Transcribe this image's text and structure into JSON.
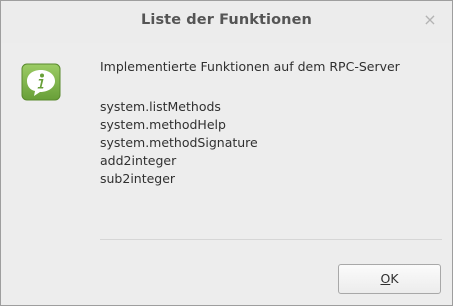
{
  "dialog": {
    "title": "Liste der Funktionen",
    "close_label": "×",
    "icon": "info-speech-bubble-icon",
    "header_message": "Implementierte Funktionen auf dem RPC-Server",
    "methods": [
      "system.listMethods",
      "system.methodHelp",
      "system.methodSignature",
      "add2integer",
      "sub2integer"
    ],
    "ok_button": {
      "mnemonic": "O",
      "rest": "K"
    }
  },
  "colors": {
    "icon_green": "#7cb342",
    "background": "#ededed",
    "text": "#303030"
  }
}
